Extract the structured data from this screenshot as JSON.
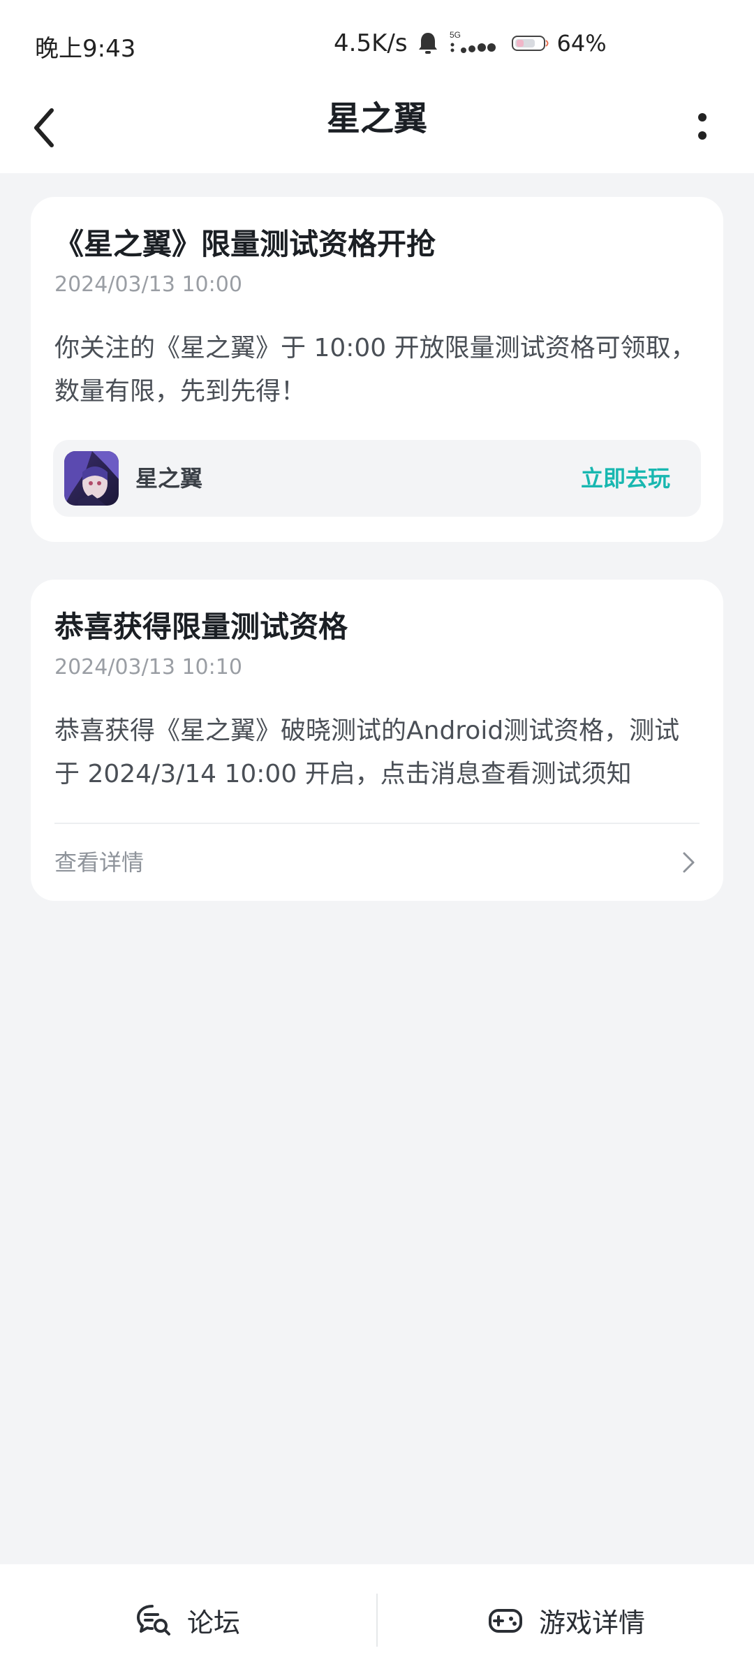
{
  "status_bar": {
    "time": "晚上9:43",
    "speed": "4.5K/s",
    "network": "5G",
    "battery": "64%"
  },
  "header": {
    "title": "星之翼"
  },
  "cards": [
    {
      "title": "《星之翼》限量测试资格开抢",
      "time": "2024/03/13 10:00",
      "body": "你关注的《星之翼》于 10:00 开放限量测试资格可领取，数量有限，先到先得！",
      "game_name": "星之翼",
      "action_label": "立即去玩"
    },
    {
      "title": "恭喜获得限量测试资格",
      "time": "2024/03/13 10:10",
      "body": "恭喜获得《星之翼》破晓测试的Android测试资格，测试于 2024/3/14 10:00 开启，点击消息查看测试须知",
      "details_label": "查看详情"
    }
  ],
  "bottom_bar": {
    "forum_label": "论坛",
    "game_details_label": "游戏详情"
  },
  "colors": {
    "accent": "#18b7b0",
    "background": "#f3f4f6",
    "card": "#ffffff"
  },
  "icons": [
    "bell-icon",
    "signal-icon",
    "battery-icon",
    "back-icon",
    "more-icon",
    "chevron-right-icon",
    "forum-icon",
    "gamepad-icon"
  ]
}
